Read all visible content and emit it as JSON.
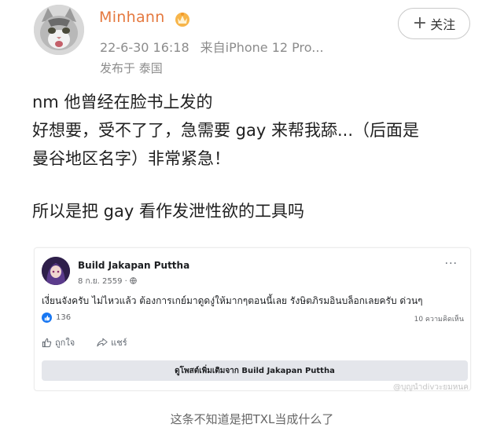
{
  "post": {
    "username": "Minhann",
    "time": "22-6-30 16:18",
    "source": "来自iPhone 12 Pro...",
    "location": "发布于 泰国",
    "follow_label": "关注",
    "body_lines": [
      "nm 他曾经在脸书上发的",
      "好想要，受不了了，急需要 gay 来帮我舔...（后面是",
      "曼谷地区名字）非常紧急！",
      "所以是把 gay 看作发泄性欲的工具吗"
    ]
  },
  "embedded_post": {
    "page_name": "Build Jakapan Puttha",
    "date": "8 ก.ย. 2559 · ",
    "text": "เงี่ยนจังครับ ไม่ไหวแล้ว ต้องการเกย์มาดูดงู่ให้มากๆตอนนี้เลย รังษิตภิรมอินบล็อกเลยครับ ด่วนๆ",
    "like_count": "136",
    "comment_count": "10 ความคิดเห็น",
    "like_label": "ถูกใจ",
    "share_label": "แชร์",
    "more_button": "ดูโพสต์เพิ่มเติมจาก Build Jakapan Puttha"
  },
  "watermark": "@บุญนำdivวะยมหนค",
  "caption": "这条不知道是把TXL当成什么了",
  "colors": {
    "username": "#e5793f",
    "meta": "#8c8c8c",
    "facebook_blue": "#1877f2"
  }
}
